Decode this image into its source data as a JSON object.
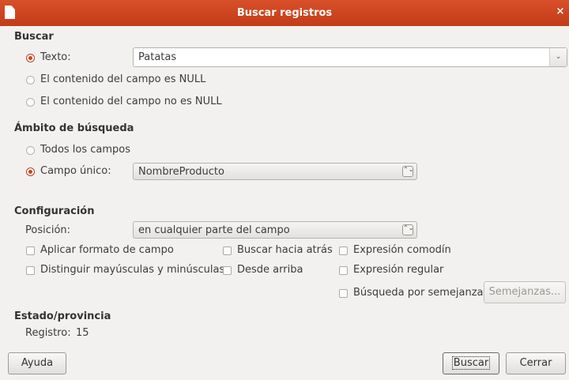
{
  "window": {
    "title": "Buscar registros",
    "close_glyph": "×"
  },
  "search": {
    "section_title": "Buscar",
    "text_label": "Texto:",
    "text_value": "Patatas",
    "null_label": "El contenido del campo es NULL",
    "not_null_label": "El contenido del campo no es NULL",
    "selected": "text"
  },
  "scope": {
    "section_title": "Ámbito de búsqueda",
    "all_fields_label": "Todos los campos",
    "single_field_label": "Campo único:",
    "single_field_value": "NombreProducto",
    "selected": "single"
  },
  "settings": {
    "section_title": "Configuración",
    "position_label": "Posición:",
    "position_value": "en cualquier parte del campo",
    "apply_format_label": "Aplicar formato de campo",
    "match_case_label": "Distinguir mayúsculas y minúsculas",
    "backwards_label": "Buscar hacia atrás",
    "from_top_label": "Desde arriba",
    "wildcard_label": "Expresión comodín",
    "regex_label": "Expresión regular",
    "similarity_label": "Búsqueda por semejanza",
    "similarities_button": "Semejanzas..."
  },
  "status": {
    "section_title": "Estado/provincia",
    "record_label": "Registro:",
    "record_value": "15"
  },
  "buttons": {
    "help": "Ayuda",
    "search": "Buscar",
    "close": "Cerrar"
  },
  "colors": {
    "titlebar": "#c94420",
    "accent": "#d2401a"
  },
  "icons": {
    "spin": "⌃⌄",
    "dropdown": "⌄"
  }
}
